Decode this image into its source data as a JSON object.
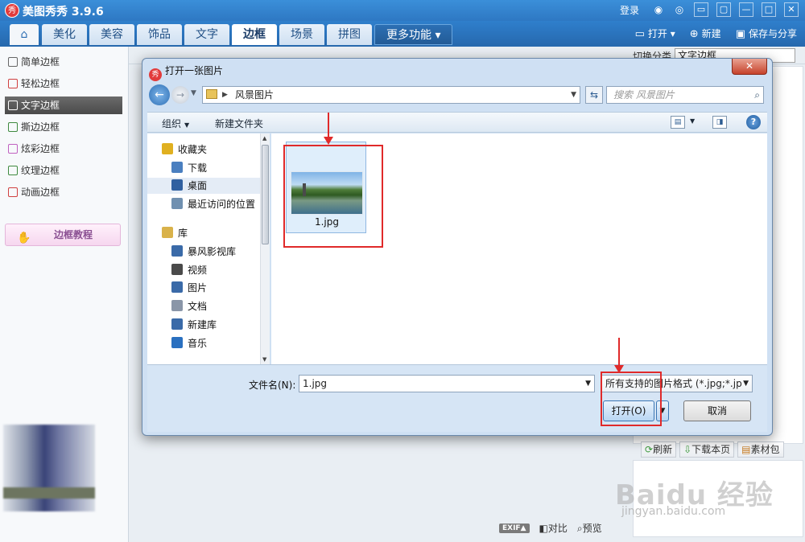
{
  "app": {
    "title": "美图秀秀 3.9.6",
    "logo_text": "秀",
    "login": "登录",
    "window_controls": [
      "▭",
      "▢",
      "—",
      "□",
      "✕"
    ]
  },
  "menubar": {
    "tabs": [
      {
        "label": "美化",
        "active": false
      },
      {
        "label": "美容",
        "active": false
      },
      {
        "label": "饰品",
        "active": false
      },
      {
        "label": "文字",
        "active": false
      },
      {
        "label": "边框",
        "active": true
      },
      {
        "label": "场景",
        "active": false
      },
      {
        "label": "拼图",
        "active": false
      },
      {
        "label": "更多功能 ▾",
        "active": false
      }
    ],
    "open": "打开",
    "new": "新建",
    "save_share": "保存与分享"
  },
  "sidebar": {
    "items": [
      {
        "label": "简单边框",
        "color": "#555555"
      },
      {
        "label": "轻松边框",
        "color": "#d04040"
      },
      {
        "label": "文字边框",
        "color": "#ffffff",
        "active": true
      },
      {
        "label": "撕边边框",
        "color": "#3f8a3f"
      },
      {
        "label": "炫彩边框",
        "color": "#c060c0"
      },
      {
        "label": "纹理边框",
        "color": "#3f8a3f"
      },
      {
        "label": "动画边框",
        "color": "#d04040"
      }
    ],
    "tutorial": "边框教程"
  },
  "background": {
    "switch_category_label": "切换分类",
    "switch_category_value": "文字边框",
    "tools": [
      "刷新",
      "下载本页",
      "素材包"
    ],
    "exif": "EXIF▲",
    "compare": "对比",
    "preview": "预览",
    "watermark": "Baidu 经验",
    "watermark_sub": "jingyan.baidu.com"
  },
  "dialog": {
    "title": "打开一张图片",
    "close": "✕",
    "address_path": "风景图片",
    "search_placeholder": "搜索 风景图片",
    "organize": "组织",
    "new_folder": "新建文件夹",
    "help": "?",
    "nav": [
      {
        "label": "收藏夹",
        "icon_color": "#e0b020",
        "level": 0
      },
      {
        "label": "下载",
        "icon_color": "#4a7fc0",
        "level": 1
      },
      {
        "label": "桌面",
        "icon_color": "#3060a0",
        "level": 1,
        "selected": true
      },
      {
        "label": "最近访问的位置",
        "icon_color": "#7090b0",
        "level": 1
      },
      {
        "label": "库",
        "icon_color": "#d9b24a",
        "level": 0
      },
      {
        "label": "暴风影视库",
        "icon_color": "#3a6aa8",
        "level": 1
      },
      {
        "label": "视频",
        "icon_color": "#4a4a4a",
        "level": 1
      },
      {
        "label": "图片",
        "icon_color": "#3a6aa8",
        "level": 1
      },
      {
        "label": "文档",
        "icon_color": "#8a96a8",
        "level": 1
      },
      {
        "label": "新建库",
        "icon_color": "#3a6aa8",
        "level": 1
      },
      {
        "label": "音乐",
        "icon_color": "#2a70c0",
        "level": 1
      }
    ],
    "files": [
      {
        "name": "1.jpg"
      }
    ],
    "filename_label": "文件名(N):",
    "filename_value": "1.jpg",
    "filetype_value": "所有支持的图片格式 (*.jpg;*.jp",
    "open_button": "打开(O)",
    "cancel_button": "取消"
  },
  "annotation_color": "#e02a2a"
}
